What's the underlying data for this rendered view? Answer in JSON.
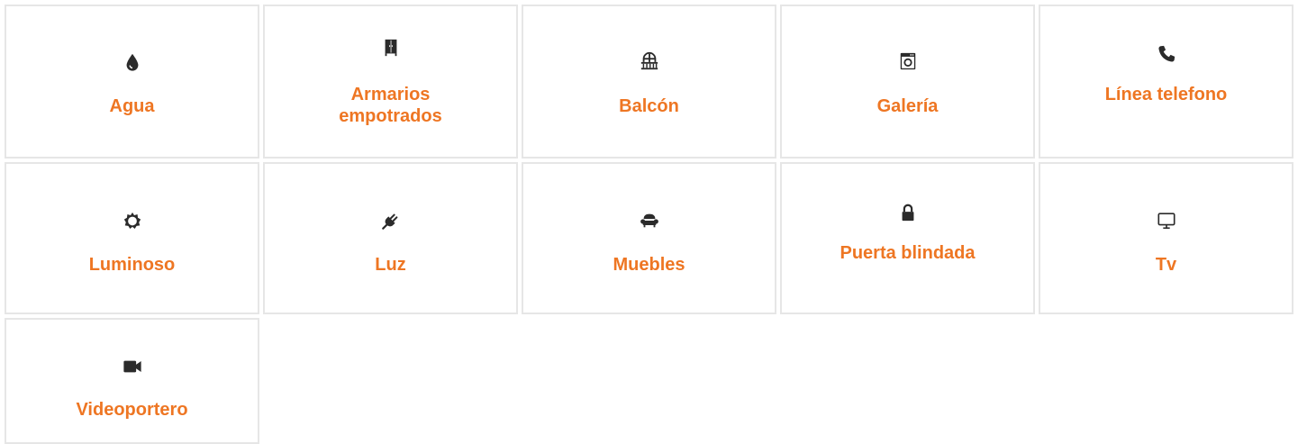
{
  "accent_color": "#ee7623",
  "border_color": "#e6e6e6",
  "icon_color": "#2b2b2b",
  "features": [
    {
      "label": "Agua",
      "icon": "water-drop-icon"
    },
    {
      "label": "Armarios empotrados",
      "icon": "wardrobe-icon"
    },
    {
      "label": "Balcón",
      "icon": "balcony-icon"
    },
    {
      "label": "Galería",
      "icon": "washing-machine-icon"
    },
    {
      "label": "Línea telefono",
      "icon": "phone-icon"
    },
    {
      "label": "Luminoso",
      "icon": "sun-icon"
    },
    {
      "label": "Luz",
      "icon": "plug-icon"
    },
    {
      "label": "Muebles",
      "icon": "armchair-icon"
    },
    {
      "label": "Puerta blindada",
      "icon": "lock-icon"
    },
    {
      "label": "Tv",
      "icon": "monitor-icon"
    },
    {
      "label": "Videoportero",
      "icon": "video-camera-icon"
    }
  ]
}
